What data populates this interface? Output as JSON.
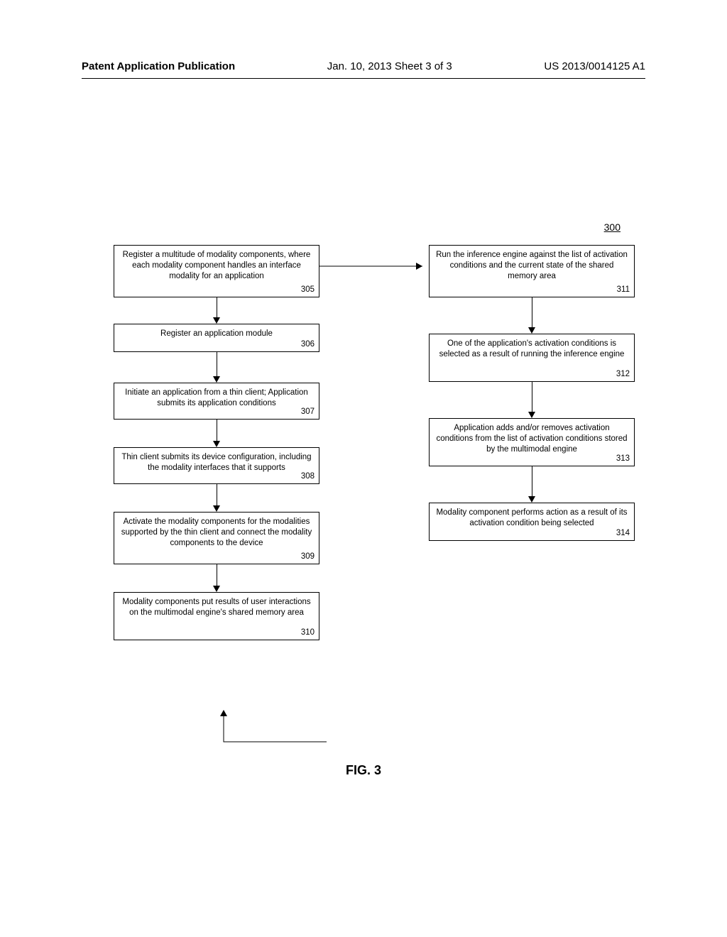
{
  "header": {
    "left": "Patent Application Publication",
    "center": "Jan. 10, 2013  Sheet 3 of 3",
    "right": "US 2013/0014125 A1"
  },
  "figure_ref": "300",
  "boxes": {
    "b305": {
      "text": "Register a multitude of modality components, where each modality component handles an interface modality for an application",
      "num": "305"
    },
    "b306": {
      "text": "Register an application module",
      "num": "306"
    },
    "b307": {
      "text": "Initiate an application from a thin client; Application submits its application conditions",
      "num": "307"
    },
    "b308": {
      "text": "Thin client submits its device configuration, including the modality interfaces that it supports",
      "num": "308"
    },
    "b309": {
      "text": "Activate the modality components for the modalities supported by the thin client and connect the modality components to the device",
      "num": "309"
    },
    "b310": {
      "text": "Modality components put results of user interactions on the multimodal engine's shared memory area",
      "num": "310"
    },
    "b311": {
      "text": "Run the inference engine against the list of activation conditions and the current state of the shared memory area",
      "num": "311"
    },
    "b312": {
      "text": "One of the application's activation conditions is selected as a result of running the inference engine",
      "num": "312"
    },
    "b313": {
      "text": "Application adds and/or removes activation conditions from the list of activation conditions stored by the multimodal engine",
      "num": "313"
    },
    "b314": {
      "text": "Modality component performs action as a result of its activation condition being selected",
      "num": "314"
    }
  },
  "caption": "FIG. 3"
}
